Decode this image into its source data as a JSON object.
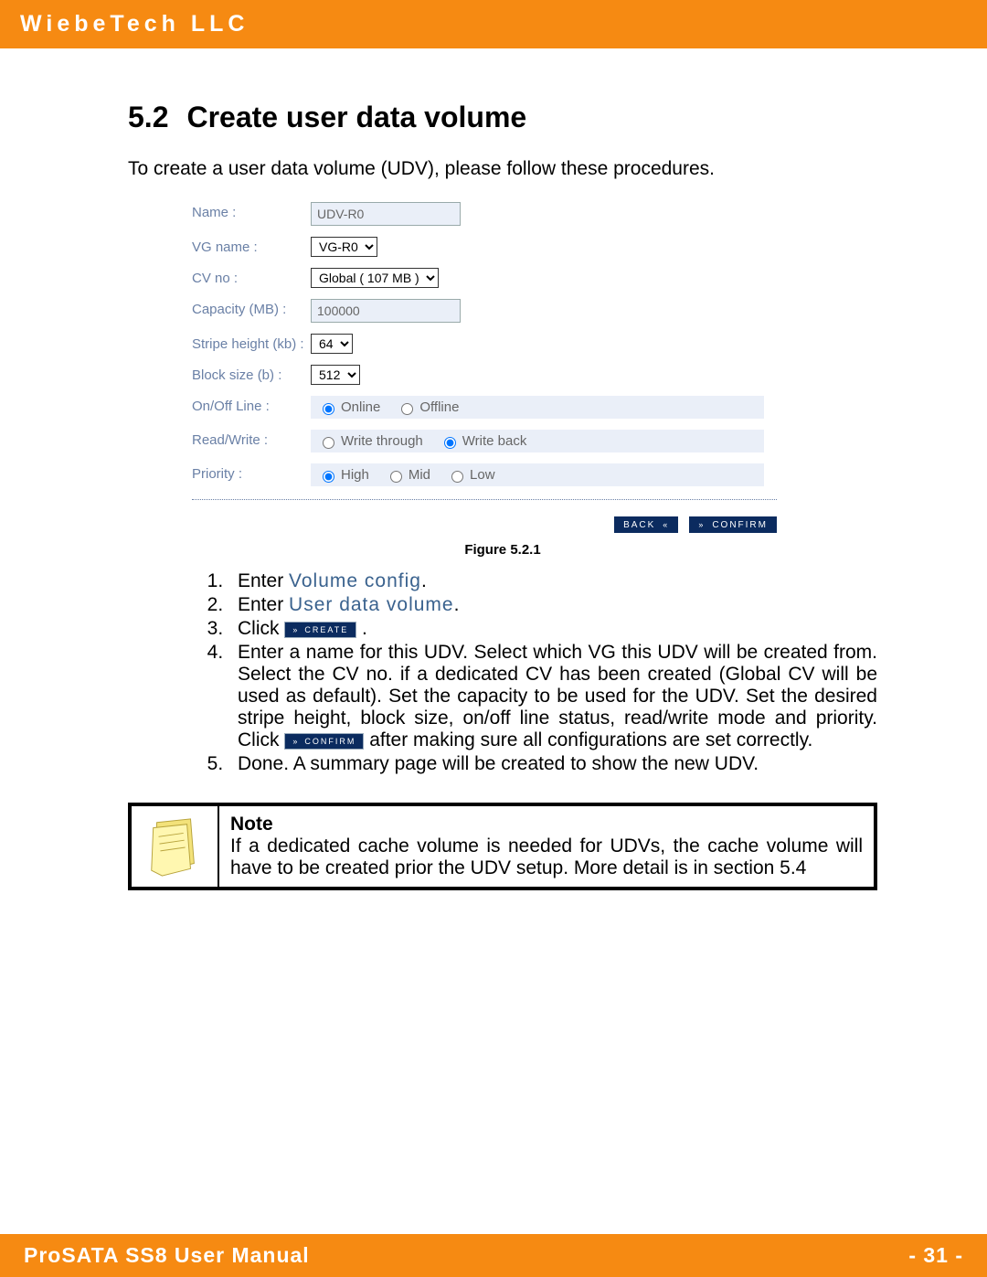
{
  "header": {
    "company": "WiebeTech LLC"
  },
  "section": {
    "number": "5.2",
    "title": "Create user data volume"
  },
  "intro": "To create a user data volume (UDV), please follow these procedures.",
  "form": {
    "name_label": "Name :",
    "name_value": "UDV-R0",
    "vg_label": "VG name :",
    "vg_value": "VG-R0",
    "cv_label": "CV no :",
    "cv_value": "Global ( 107 MB )",
    "cap_label": "Capacity (MB) :",
    "cap_value": "100000",
    "stripe_label": "Stripe height (kb) :",
    "stripe_value": "64",
    "block_label": "Block size (b) :",
    "block_value": "512",
    "onoff_label": "On/Off Line :",
    "online": "Online",
    "offline": "Offline",
    "rw_label": "Read/Write :",
    "wt": "Write through",
    "wb": "Write back",
    "prio_label": "Priority :",
    "high": "High",
    "mid": "Mid",
    "low": "Low",
    "back_btn": "BACK",
    "confirm_btn": "CONFIRM"
  },
  "figure_caption": "Figure 5.2.1",
  "steps": {
    "s1_a": "Enter ",
    "s1_link": "Volume config",
    "s1_b": ".",
    "s2_a": "Enter ",
    "s2_link": "User data volume",
    "s2_b": ".",
    "s3_a": "Click ",
    "s3_btn": "CREATE",
    "s3_b": " .",
    "s4_a": "Enter a name for this UDV. Select which VG this UDV will be created from. Select the CV no. if a dedicated CV has been created (Global CV will be used as default).  Set the capacity to be used for the UDV. Set the desired stripe height, block size, on/off line status, read/write mode and priority. Click ",
    "s4_btn": "CONFIRM",
    "s4_b": " after making sure all configurations are set correctly.",
    "s5": "Done. A summary page will be created to show the new UDV."
  },
  "note": {
    "title": "Note",
    "body": "If a dedicated cache volume is needed for UDVs, the cache volume will have to be created prior the UDV setup. More detail is in section 5.4"
  },
  "footer": {
    "title": "ProSATA SS8 User Manual",
    "page": "- 31 -"
  }
}
